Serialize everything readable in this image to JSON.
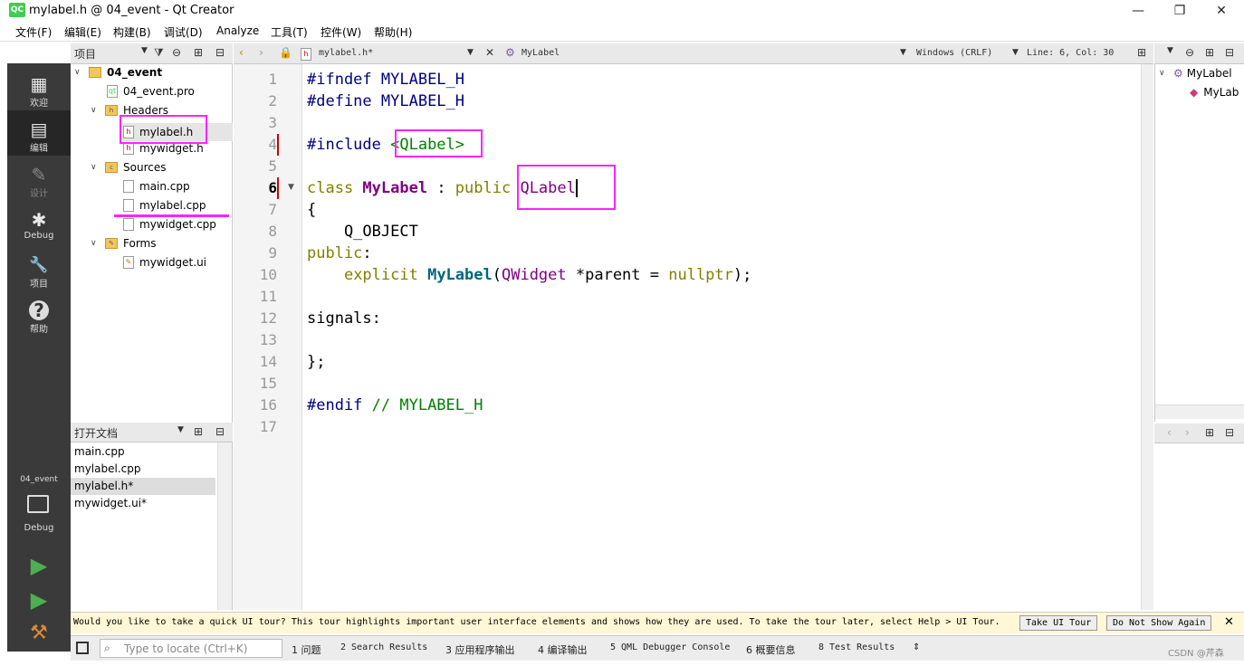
{
  "window": {
    "title": "mylabel.h @ 04_event - Qt Creator",
    "logo": "QC",
    "minimize": "—",
    "maximize": "❐",
    "close": "✕"
  },
  "menu": [
    "文件(F)",
    "编辑(E)",
    "构建(B)",
    "调试(D)",
    "Analyze",
    "工具(T)",
    "控件(W)",
    "帮助(H)"
  ],
  "modes": [
    {
      "label": "欢迎",
      "icon": "grid-icon",
      "glyph": "▦"
    },
    {
      "label": "编辑",
      "icon": "edit-doc-icon",
      "glyph": "▤"
    },
    {
      "label": "设计",
      "icon": "pen-icon",
      "glyph": "✎"
    },
    {
      "label": "Debug",
      "icon": "bug-icon",
      "glyph": "✱"
    },
    {
      "label": "项目",
      "icon": "wrench-icon",
      "glyph": "🔧"
    },
    {
      "label": "帮助",
      "icon": "help-icon",
      "glyph": "?"
    }
  ],
  "kit": {
    "project": "04_event",
    "config": "Debug"
  },
  "run_glyph": "▶",
  "build_glyph": "⚒",
  "project_panel": {
    "title": "项目"
  },
  "tree": {
    "root": "04_event",
    "pro": "04_event.pro",
    "headers": "Headers",
    "h1": "mylabel.h",
    "h2": "mywidget.h",
    "sources": "Sources",
    "s1": "main.cpp",
    "s2": "mylabel.cpp",
    "s3": "mywidget.cpp",
    "forms": "Forms",
    "f1": "mywidget.ui"
  },
  "open_docs": {
    "title": "打开文档",
    "items": [
      "main.cpp",
      "mylabel.cpp",
      "mylabel.h*",
      "mywidget.ui*"
    ]
  },
  "editor_toolbar": {
    "file": "mylabel.h*",
    "symbol": "MyLabel",
    "encoding": "Windows (CRLF)",
    "position": "Line: 6, Col: 30"
  },
  "line_numbers": [
    "1",
    "2",
    "3",
    "4",
    "5",
    "6",
    "7",
    "8",
    "9",
    "10",
    "11",
    "12",
    "13",
    "14",
    "15",
    "16",
    "17"
  ],
  "code": {
    "l1a": "#ifndef",
    "l1b": " MYLABEL_H",
    "l2a": "#define",
    "l2b": " MYLABEL_H",
    "l4a": "#include ",
    "l4b": "<QLabel>",
    "l6a": "class ",
    "l6b": "MyLabel",
    "l6c": " : ",
    "l6d": "public ",
    "l6e": "QLabel",
    "l7": "{",
    "l8": "    Q_OBJECT",
    "l9a": "public",
    "l9b": ":",
    "l10a": "    ",
    "l10b": "explicit ",
    "l10c": "MyLabel",
    "l10d": "(",
    "l10e": "QWidget",
    "l10f": " *parent = ",
    "l10g": "nullptr",
    "l10h": ");",
    "l12": "signals:",
    "l14": "};",
    "l16a": "#endif",
    "l16b": " // MYLABEL_H"
  },
  "outline": {
    "root": "MyLabel",
    "child": "MyLab"
  },
  "tour": {
    "text": "Would you like to take a quick UI tour? This tour highlights important user interface elements and shows how they are used. To take the tour later, select Help > UI Tour.",
    "take": "Take UI Tour",
    "dismiss": "Do Not Show Again",
    "close": "✕"
  },
  "status": {
    "locator_placeholder": "Type to locate (Ctrl+K)",
    "tabs": [
      "1 问题",
      "2 Search Results",
      "3 应用程序输出",
      "4 编译输出",
      "5 QML Debugger Console",
      "6 概要信息",
      "8 Test Results"
    ],
    "watermark": "CSDN @芹森"
  }
}
